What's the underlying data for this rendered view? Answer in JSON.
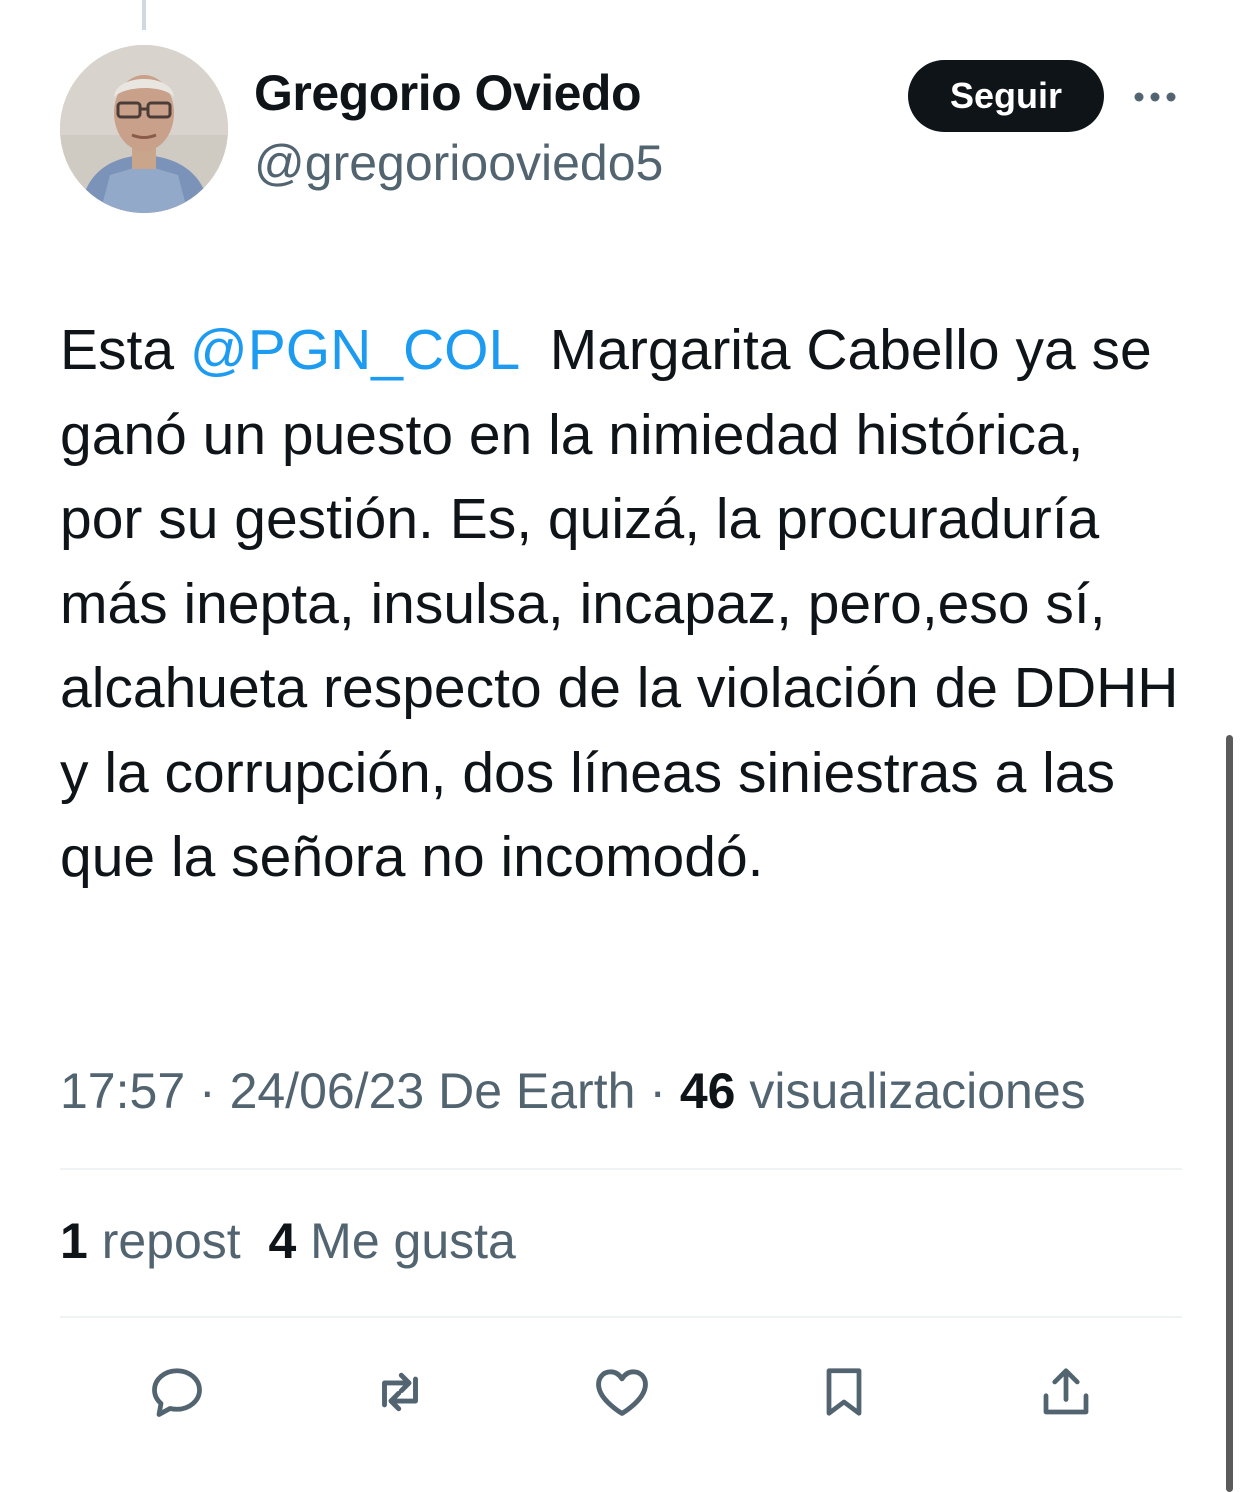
{
  "author": {
    "display_name": "Gregorio Oviedo",
    "handle": "@gregoriooviedo5"
  },
  "follow_button": "Seguir",
  "tweet": {
    "prefix": "Esta ",
    "mention": "@PGN_COL",
    "body": "  Margarita Cabello ya se ganó un puesto en la nimiedad histórica, por su gestión. Es, quizá, la procuraduría más inepta, insulsa, incapaz, pero,eso sí, alcahueta respecto de la violación de DDHH y la corrupción, dos líneas siniestras a las que la señora no incomodó."
  },
  "meta": {
    "time": "17:57",
    "sep1": " · ",
    "date": "24/06/23",
    "source": " De Earth",
    "sep2": " · ",
    "views_count": "46",
    "views_label": " visualizaciones"
  },
  "stats": {
    "reposts_count": "1",
    "reposts_label": " repost",
    "likes_count": "4",
    "likes_label": " Me gusta"
  },
  "icons": {
    "reply": "reply-icon",
    "repost": "repost-icon",
    "like": "heart-icon",
    "bookmark": "bookmark-icon",
    "share": "share-icon",
    "more": "more-icon"
  },
  "colors": {
    "text": "#0f1419",
    "secondary": "#536471",
    "link": "#1d9bf0",
    "divider": "#eff3f4"
  }
}
